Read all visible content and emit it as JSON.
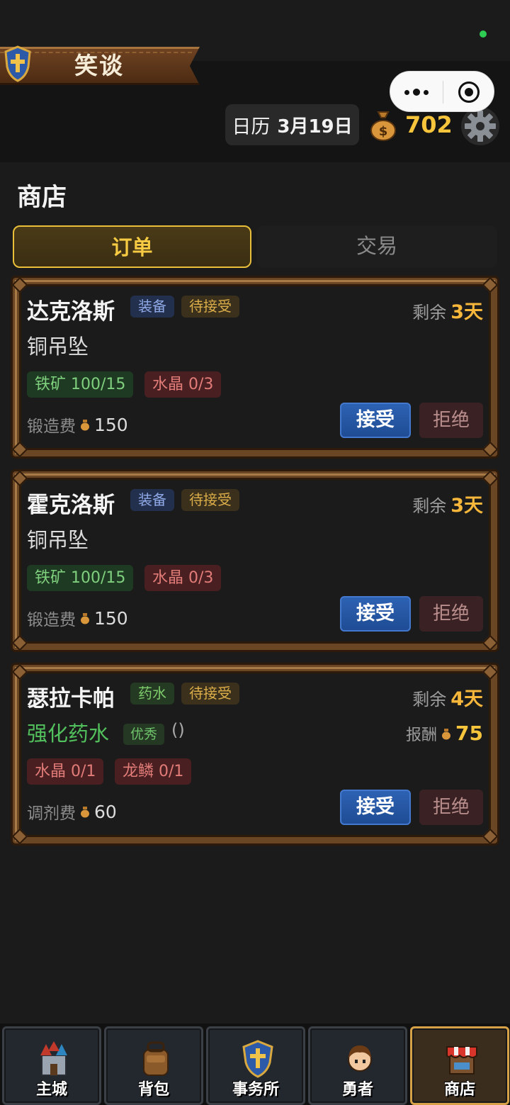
{
  "header": {
    "player_name": "笑谈",
    "date_label": "日历",
    "date_value": "3月19日",
    "gold": "702",
    "icons": {
      "emblem": "shield-cross-icon",
      "coin": "money-bag-icon",
      "settings": "gear-icon"
    }
  },
  "page_title": "商店",
  "tabs": [
    {
      "label": "订单",
      "active": true
    },
    {
      "label": "交易",
      "active": false
    }
  ],
  "common": {
    "remaining_label": "剩余",
    "accept_label": "接受",
    "reject_label": "拒绝",
    "reward_label": "报酬"
  },
  "orders": [
    {
      "customer": "达克洛斯",
      "category": "装备",
      "status": "待接受",
      "days_left": "3天",
      "item": "铜吊坠",
      "materials": [
        {
          "text": "铁矿 100/15",
          "sufficient": true
        },
        {
          "text": "水晶 0/3",
          "sufficient": false
        }
      ],
      "fee_label": "锻造费",
      "fee": "150"
    },
    {
      "customer": "霍克洛斯",
      "category": "装备",
      "status": "待接受",
      "days_left": "3天",
      "item": "铜吊坠",
      "materials": [
        {
          "text": "铁矿 100/15",
          "sufficient": true
        },
        {
          "text": "水晶 0/3",
          "sufficient": false
        }
      ],
      "fee_label": "锻造费",
      "fee": "150"
    },
    {
      "customer": "瑟拉卡帕",
      "category": "药水",
      "status": "待接受",
      "days_left": "4天",
      "item": "强化药水",
      "quality": "优秀",
      "quality_extra": "()",
      "reward": "75",
      "materials": [
        {
          "text": "水晶 0/1",
          "sufficient": false
        },
        {
          "text": "龙鳞 0/1",
          "sufficient": false
        }
      ],
      "fee_label": "调剂费",
      "fee": "60"
    }
  ],
  "bottom_nav": [
    {
      "label": "主城",
      "icon": "castle-icon",
      "active": false
    },
    {
      "label": "背包",
      "icon": "backpack-icon",
      "active": false
    },
    {
      "label": "事务所",
      "icon": "shield-cross-icon",
      "active": false
    },
    {
      "label": "勇者",
      "icon": "hero-portrait-icon",
      "active": false
    },
    {
      "label": "商店",
      "icon": "shop-stall-icon",
      "active": true
    }
  ],
  "colors": {
    "gold": "#f6c53c",
    "accept_blue": "#2d62b3",
    "frame_brown": "#6b4624",
    "tab_active": "#e9bf3a"
  }
}
